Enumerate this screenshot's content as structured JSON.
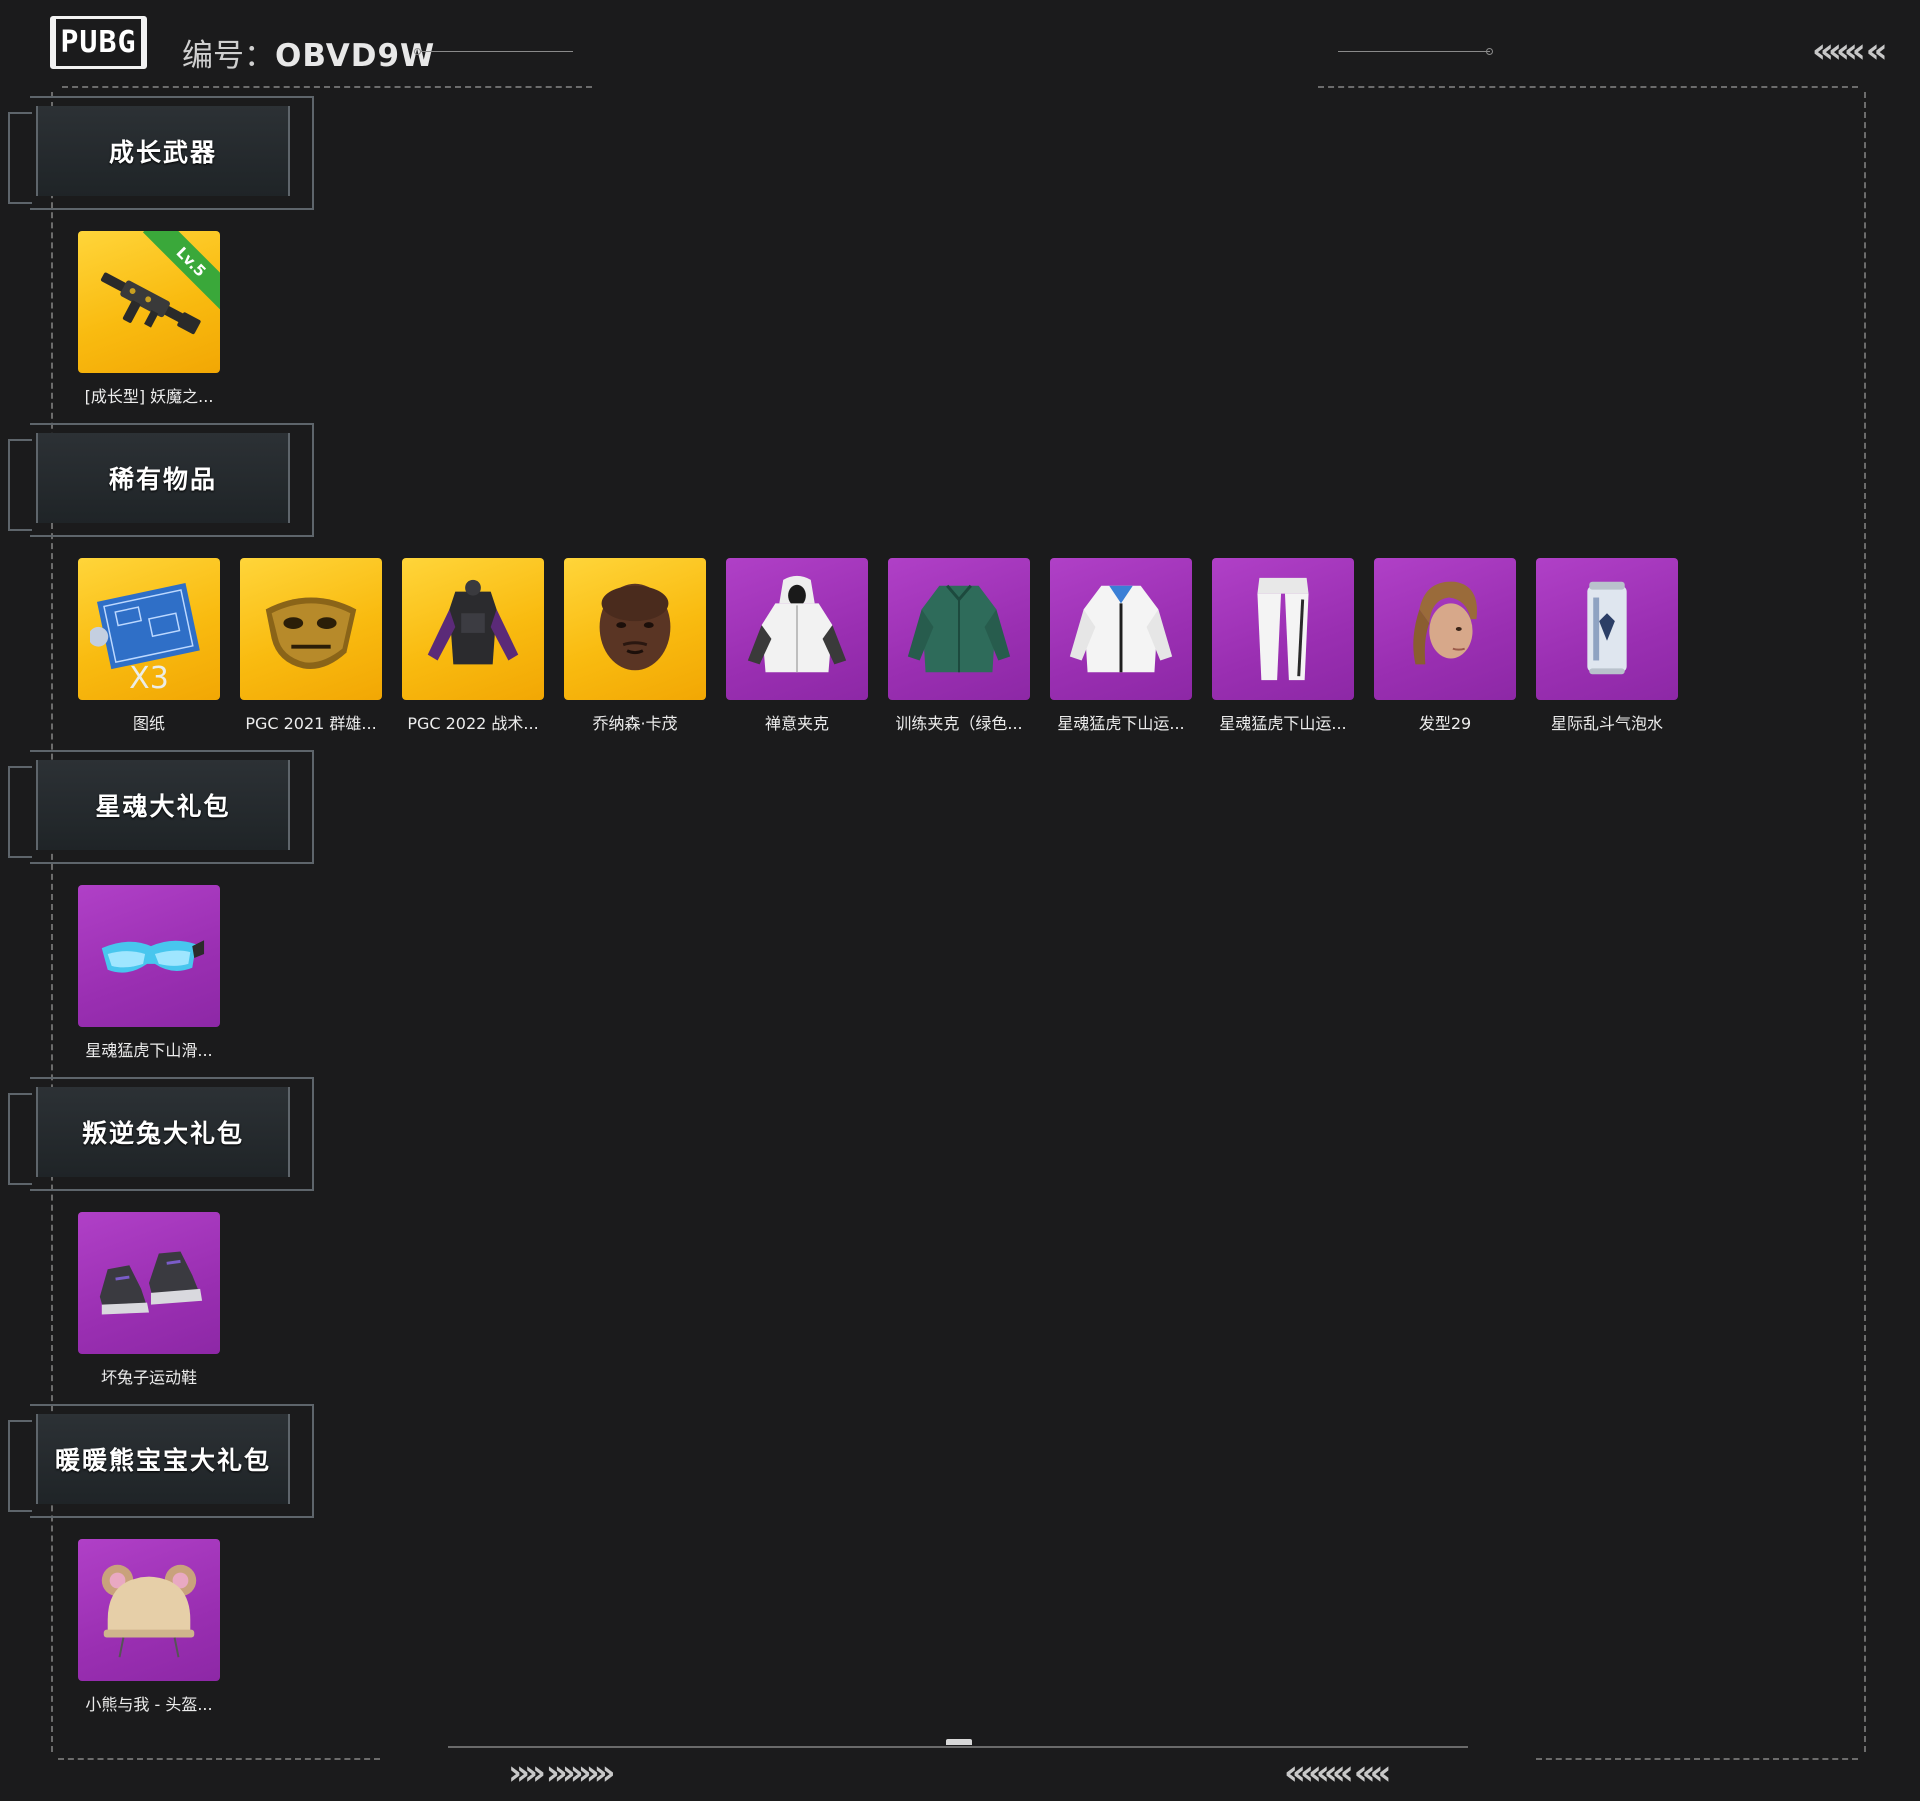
{
  "header": {
    "logo_text": "PUBG",
    "serial_label": "编号：",
    "serial_value": "OBVD9W"
  },
  "decor": {
    "top_right_chevrons": "«««  «",
    "bottom_left_chevrons": "»»  »»»»",
    "bottom_right_chevrons": "««««  ««"
  },
  "sections": [
    {
      "title": "成长武器",
      "items": [
        {
          "label": "[成长型] 妖魔之...",
          "rarity": "gold",
          "icon": "rifle-icon",
          "badge": "Lv.5"
        }
      ]
    },
    {
      "title": "稀有物品",
      "items": [
        {
          "label": "图纸",
          "rarity": "gold",
          "icon": "blueprint-icon",
          "quantity": "X3"
        },
        {
          "label": "PGC 2021 群雄...",
          "rarity": "gold",
          "icon": "gold-mask-icon"
        },
        {
          "label": "PGC 2022 战术...",
          "rarity": "gold",
          "icon": "tactical-vest-icon"
        },
        {
          "label": "乔纳森·卡茂",
          "rarity": "gold",
          "icon": "character-face-icon"
        },
        {
          "label": "禅意夹克",
          "rarity": "purple",
          "icon": "hooded-jacket-icon"
        },
        {
          "label": "训练夹克（绿色...",
          "rarity": "purple",
          "icon": "green-jacket-icon"
        },
        {
          "label": "星魂猛虎下山运...",
          "rarity": "purple",
          "icon": "white-jacket-icon"
        },
        {
          "label": "星魂猛虎下山运...",
          "rarity": "purple",
          "icon": "white-pants-icon"
        },
        {
          "label": "发型29",
          "rarity": "purple",
          "icon": "hairstyle-icon"
        },
        {
          "label": "星际乱斗气泡水",
          "rarity": "purple",
          "icon": "soda-can-icon"
        }
      ]
    },
    {
      "title": "星魂大礼包",
      "items": [
        {
          "label": "星魂猛虎下山滑...",
          "rarity": "purple",
          "icon": "goggles-icon"
        }
      ]
    },
    {
      "title": "叛逆兔大礼包",
      "items": [
        {
          "label": "坏兔子运动鞋",
          "rarity": "purple",
          "icon": "sneakers-icon"
        }
      ]
    },
    {
      "title": "暖暖熊宝宝大礼包",
      "items": [
        {
          "label": "小熊与我 - 头盔...",
          "rarity": "purple",
          "icon": "bear-helmet-icon"
        }
      ]
    }
  ]
}
